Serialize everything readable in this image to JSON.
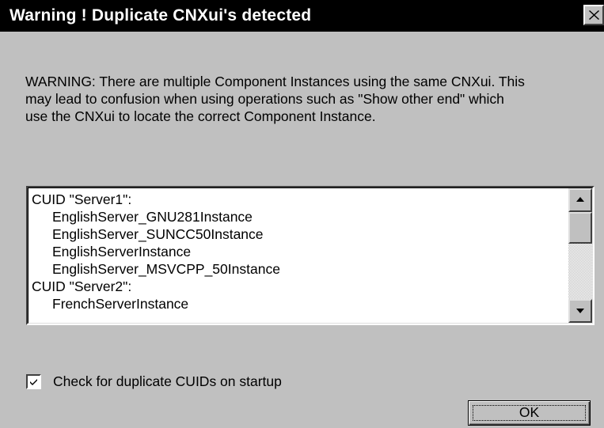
{
  "window": {
    "title": "Warning ! Duplicate CNXui's detected",
    "close_glyph": "✕"
  },
  "message": {
    "text": "WARNING: There are multiple Component Instances using the same CNXui. This\nmay lead to confusion when using operations such as \"Show other end\" which\nuse the CNXui to locate the correct Component Instance."
  },
  "list": {
    "lines": [
      {
        "text": "CUID \"Server1\":",
        "indent": false
      },
      {
        "text": "EnglishServer_GNU281Instance",
        "indent": true
      },
      {
        "text": "EnglishServer_SUNCC50Instance",
        "indent": true
      },
      {
        "text": "EnglishServerInstance",
        "indent": true
      },
      {
        "text": "EnglishServer_MSVCPP_50Instance",
        "indent": true
      },
      {
        "text": "CUID \"Server2\":",
        "indent": false
      },
      {
        "text": "FrenchServerInstance",
        "indent": true
      }
    ]
  },
  "checkbox": {
    "label": "Check for duplicate CUIDs on startup",
    "checked": true
  },
  "buttons": {
    "ok_label": "OK"
  },
  "colors": {
    "titlebar_bg": "#000000",
    "titlebar_text": "#ffffff",
    "dialog_bg": "#c0c0c0",
    "list_bg": "#ffffff"
  }
}
